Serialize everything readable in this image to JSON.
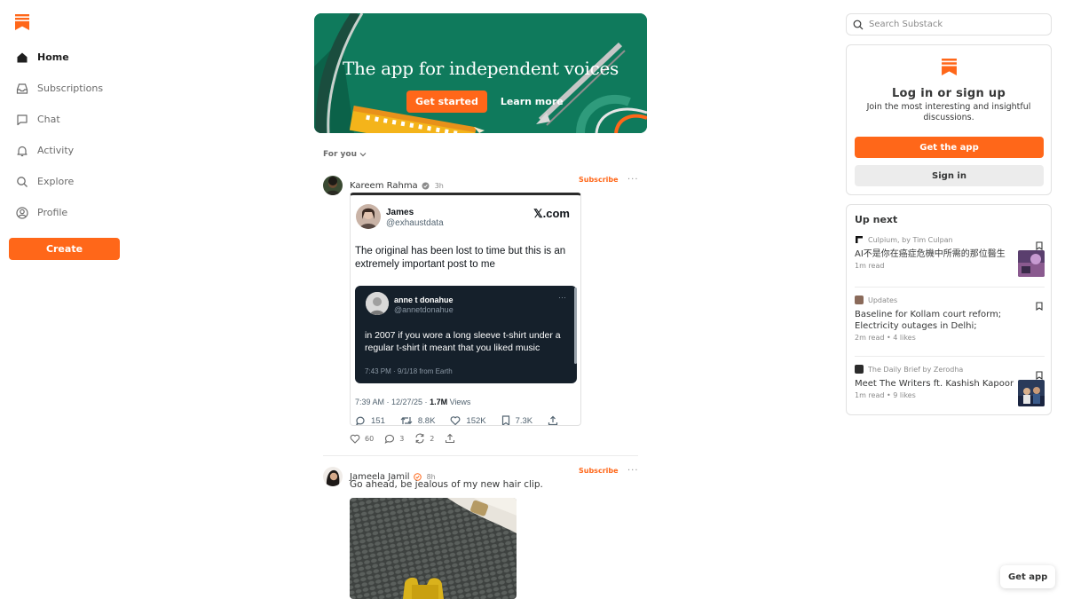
{
  "sidebar": {
    "items": [
      {
        "label": "Home",
        "icon": "home-icon",
        "active": true
      },
      {
        "label": "Subscriptions",
        "icon": "inbox-icon"
      },
      {
        "label": "Chat",
        "icon": "chat-icon"
      },
      {
        "label": "Activity",
        "icon": "bell-icon"
      },
      {
        "label": "Explore",
        "icon": "search-icon"
      },
      {
        "label": "Profile",
        "icon": "profile-icon"
      }
    ],
    "create_label": "Create"
  },
  "hero": {
    "title": "The app for independent voices",
    "get_started": "Get started",
    "learn_more": "Learn more"
  },
  "feed": {
    "filter_label": "For you",
    "subscribe_label": "Subscribe",
    "more_label": "···",
    "posts": [
      {
        "author": "Kareem Rahma",
        "time": "3h",
        "embed": {
          "name": "James",
          "handle": "@exhaustdata",
          "brand": "𝕏.com",
          "text": "The original has been lost to time but this is an extremely important post to me",
          "quote": {
            "name": "anne t donahue",
            "handle": "@annetdonahue",
            "text": "in 2007 if you wore a long sleeve t-shirt under a regular t-shirt it meant that you liked music",
            "time": "7:43 PM · 9/1/18 from Earth"
          },
          "meta_time": "7:39 AM · 12/27/25 · ",
          "meta_views": "1.7M",
          "meta_views_label": " Views",
          "replies": "151",
          "reposts": "8.8K",
          "likes": "152K",
          "bookmarks": "7.3K"
        },
        "likes": "60",
        "comments": "3",
        "restacks": "2"
      },
      {
        "author": "Jameela Jamil",
        "time": "8h",
        "text": "Go ahead, be jealous of my new hair clip."
      }
    ]
  },
  "search": {
    "placeholder": "Search Substack"
  },
  "login": {
    "title": "Log in or sign up",
    "subtitle": "Join the most interesting and insightful discussions.",
    "get_app": "Get the app",
    "sign_in": "Sign in"
  },
  "up_next": {
    "title": "Up next",
    "items": [
      {
        "source": "Culpium, by Tim Culpan",
        "headline": "AI不是你在癌症危機中所需的那位醫生",
        "meta": "1m read"
      },
      {
        "source": "Updates",
        "headline": "Baseline for Kollam court reform; Electricity outages in Delhi;",
        "meta": "2m read • 4 likes"
      },
      {
        "source": "The Daily Brief by Zerodha",
        "headline": "Meet The Writers ft. Kashish Kapoor",
        "meta": "1m read • 9 likes"
      }
    ]
  },
  "float_get_app": "Get app",
  "colors": {
    "brand": "#ff6719",
    "hero_bg": "#0f7a5c"
  }
}
